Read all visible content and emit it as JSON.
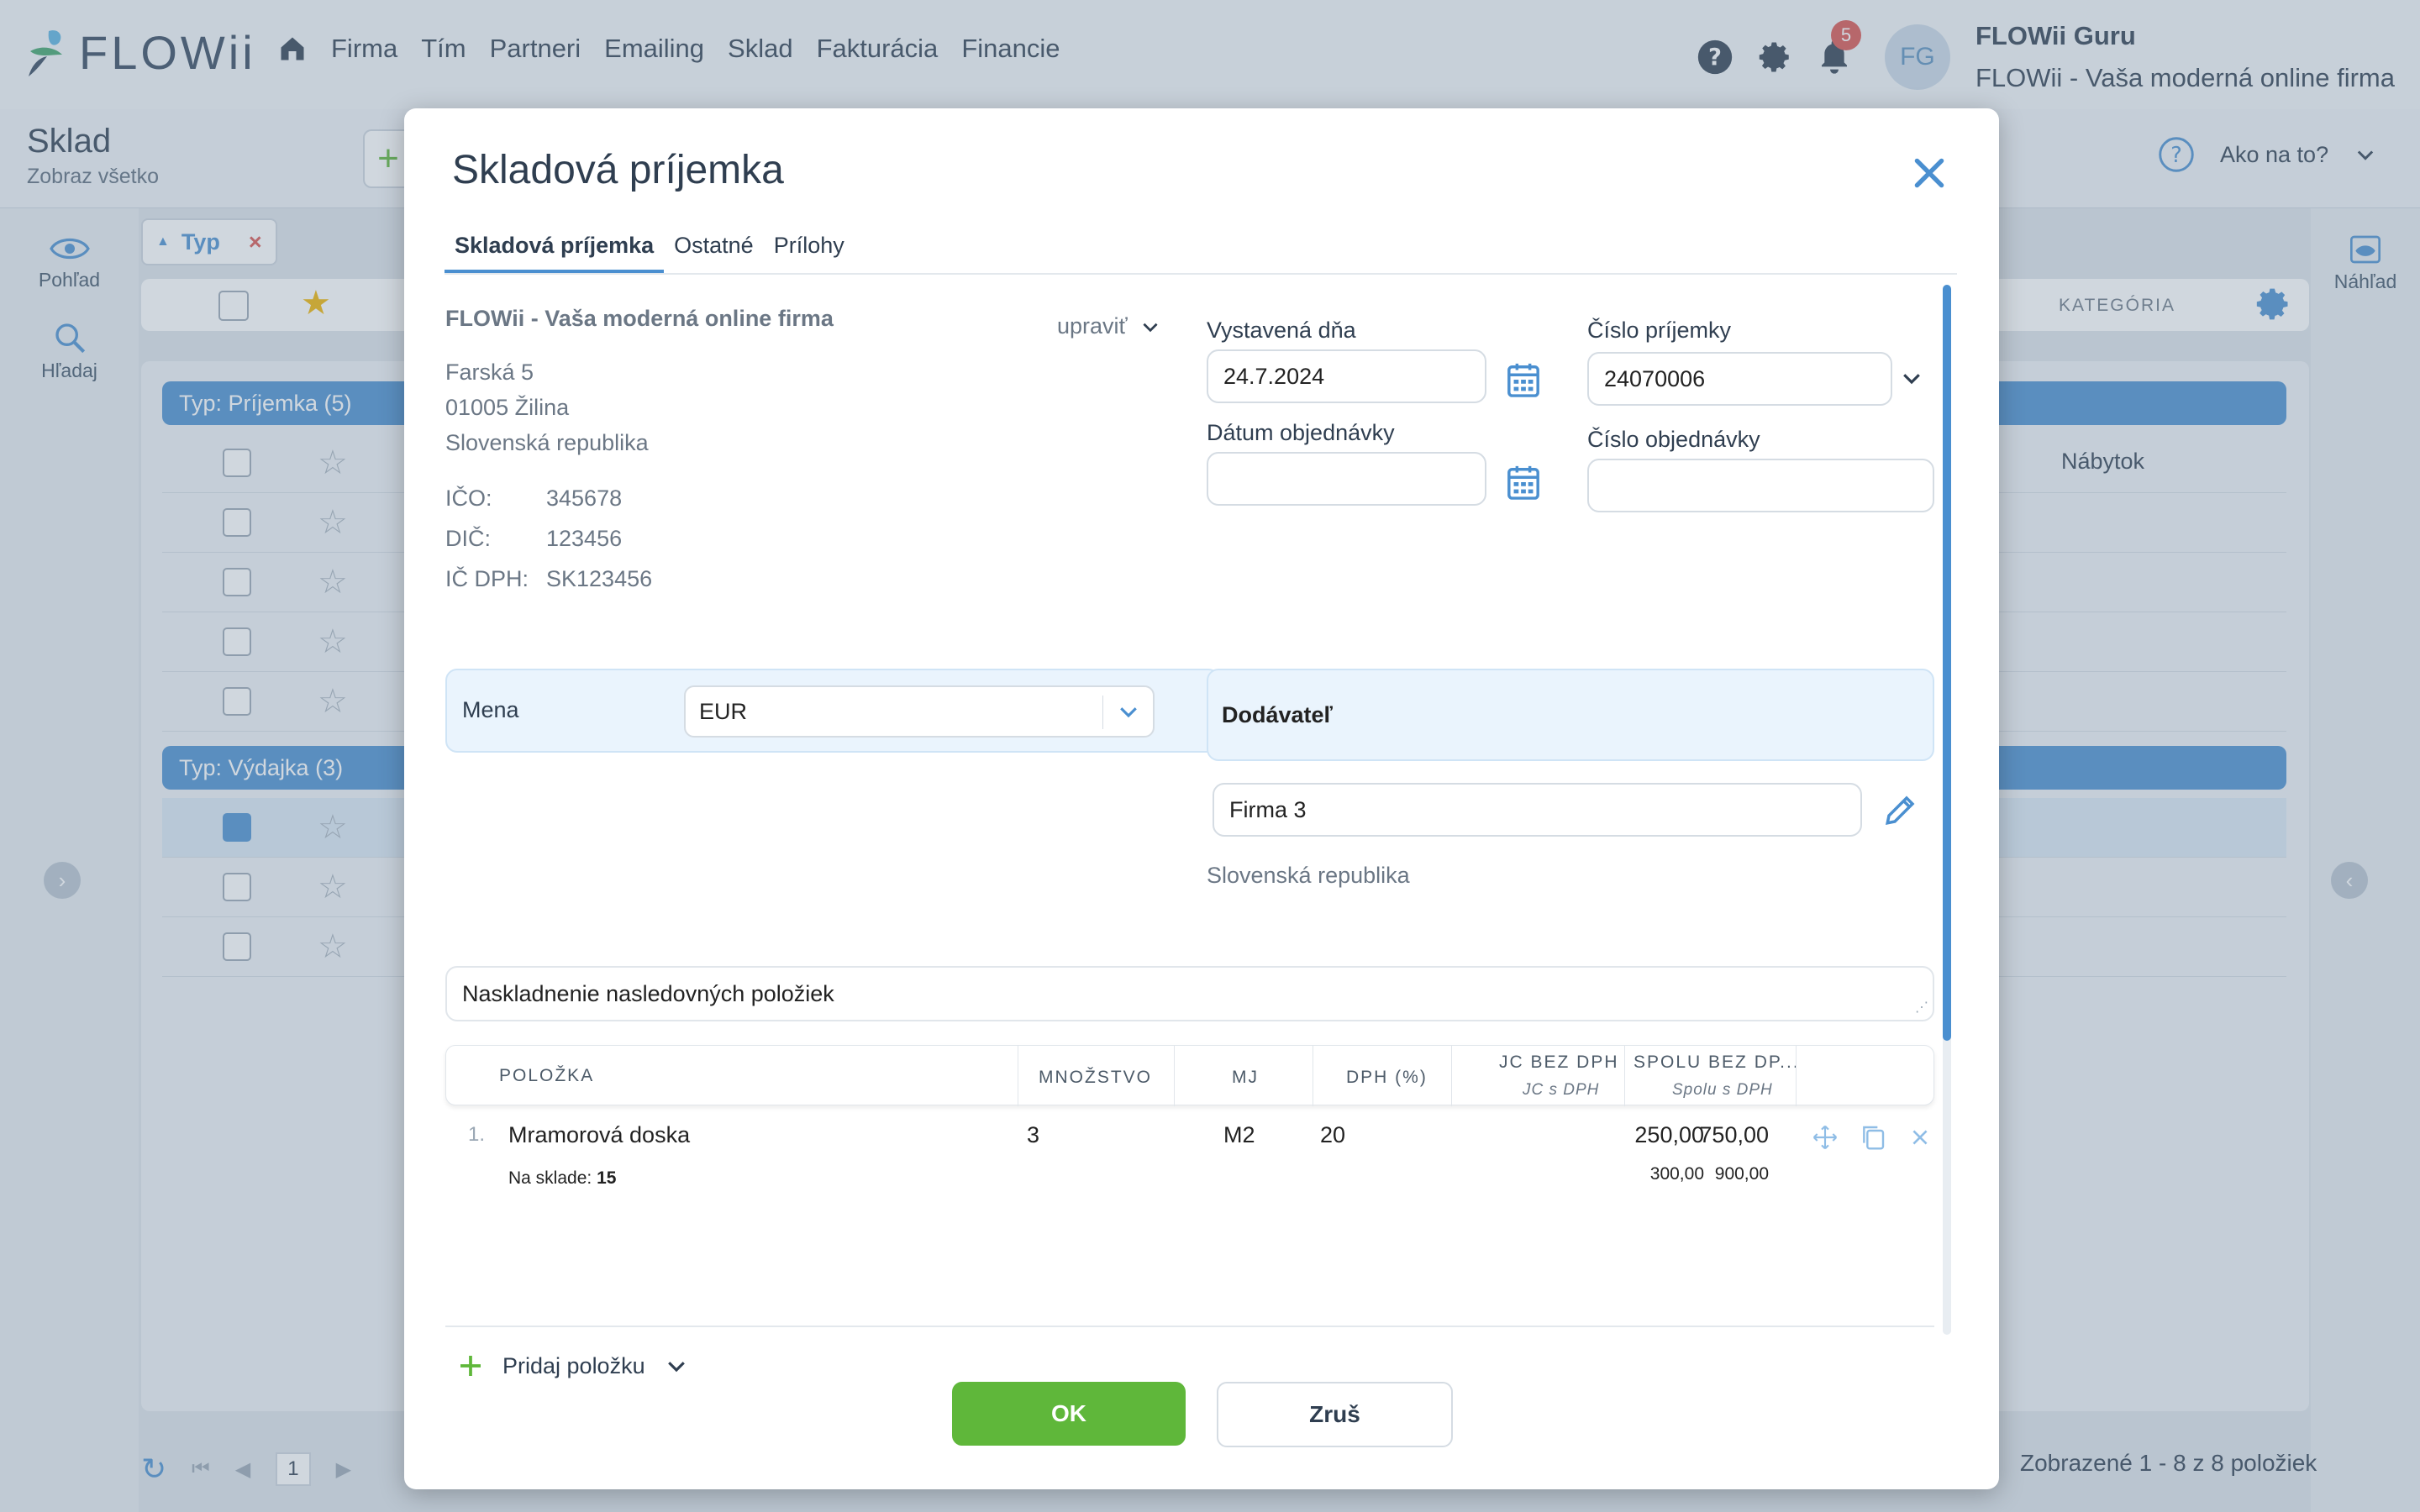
{
  "app": {
    "logo_text": "FLOWii",
    "nav": [
      "Firma",
      "Tím",
      "Partneri",
      "Emailing",
      "Sklad",
      "Fakturácia",
      "Financie"
    ],
    "notification_count": "5",
    "avatar_initials": "FG",
    "user_name": "FLOWii Guru",
    "user_firm": "FLOWii - Vaša moderná online firma"
  },
  "page": {
    "title": "Sklad",
    "subtitle": "Zobraz všetko",
    "help_label": "Ako na to?",
    "filter_chip": "Typ",
    "column_category": "KATEGÓRIA",
    "rail_left": [
      "Pohľad",
      "Hľadaj"
    ],
    "rail_right": "Náhľad",
    "group_prijemka": "Typ: Príjemka (5)",
    "group_vydajka": "Typ: Výdajka (3)",
    "first_row_category": "Nábytok",
    "pagination_page": "1",
    "footer_count": "Zobrazené 1 - 8 z 8 položiek"
  },
  "modal": {
    "title": "Skladová príjemka",
    "tabs": [
      "Skladová príjemka",
      "Ostatné",
      "Prílohy"
    ],
    "firm": {
      "name": "FLOWii - Vaša moderná online firma",
      "edit_label": "upraviť",
      "street": "Farská 5",
      "city": "01005 Žilina",
      "country": "Slovenská republika",
      "ico_label": "IČO:",
      "ico": "345678",
      "dic_label": "DIČ:",
      "dic": "123456",
      "icdph_label": "IČ DPH:",
      "icdph": "SK123456"
    },
    "fields": {
      "issued_label": "Vystavená dňa",
      "issued_value": "24.7.2024",
      "order_date_label": "Dátum objednávky",
      "order_date_value": "",
      "receipt_no_label": "Číslo príjemky",
      "receipt_no_value": "24070006",
      "order_no_label": "Číslo objednávky",
      "order_no_value": ""
    },
    "currency": {
      "label": "Mena",
      "value": "EUR"
    },
    "supplier": {
      "label": "Dodávateľ",
      "name": "Firma 3",
      "country": "Slovenská republika"
    },
    "note": "Naskladnenie nasledovných položiek",
    "table": {
      "headers": {
        "item": "POLOŽKA",
        "qty": "MNOŽSTVO",
        "unit": "MJ",
        "vat": "DPH (%)",
        "unit_price": "JC BEZ DPH",
        "unit_price_sub": "JC s DPH",
        "total": "SPOLU BEZ DP...",
        "total_sub": "Spolu s DPH"
      },
      "rows": [
        {
          "no": "1.",
          "name": "Mramorová doska",
          "stock_label": "Na sklade:",
          "stock_value": "15",
          "qty": "3",
          "unit": "M2",
          "vat": "20",
          "unit_price": "250,00",
          "unit_price_vat": "300,00",
          "total": "750,00",
          "total_vat": "900,00"
        }
      ]
    },
    "add_item_label": "Pridaj položku",
    "ok_label": "OK",
    "cancel_label": "Zruš"
  },
  "colors": {
    "accent": "#4a8fd0",
    "ok": "#5fb73a",
    "panel": "#eaf4fd"
  }
}
